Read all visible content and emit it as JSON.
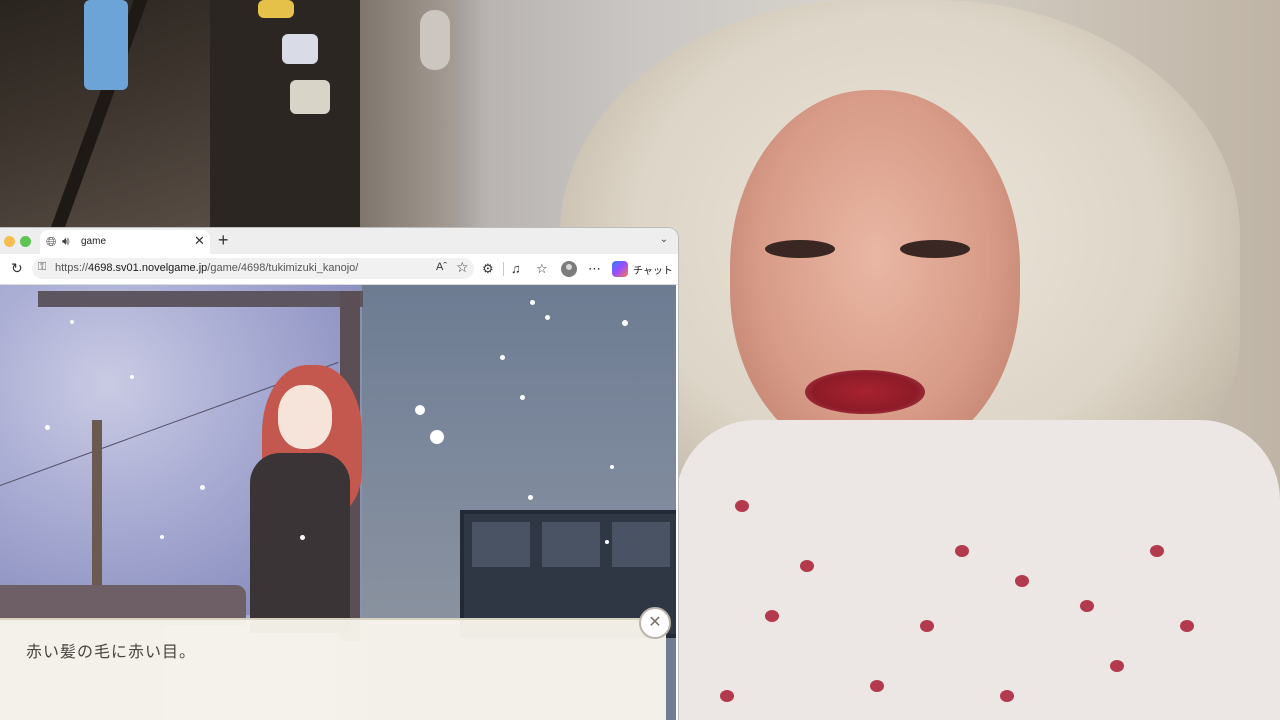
{
  "browser": {
    "tab": {
      "title": "game",
      "icon": "globe-icon",
      "audio_icon": "speaker-icon",
      "close_label": "✕"
    },
    "new_tab_label": "+",
    "tab_menu_label": "⌄",
    "address": {
      "url_scheme": "https://",
      "url_host": "4698.sv01.novelgame.jp",
      "url_path": "/game/4698/tukimizuki_kanojo/"
    },
    "copilot_label": "チャット",
    "colors": {
      "traffic_yellow": "#f5be4f",
      "traffic_green": "#5ec454"
    }
  },
  "game": {
    "dialogue_text": "赤い髪の毛に赤い目。",
    "close_label": "✕"
  }
}
